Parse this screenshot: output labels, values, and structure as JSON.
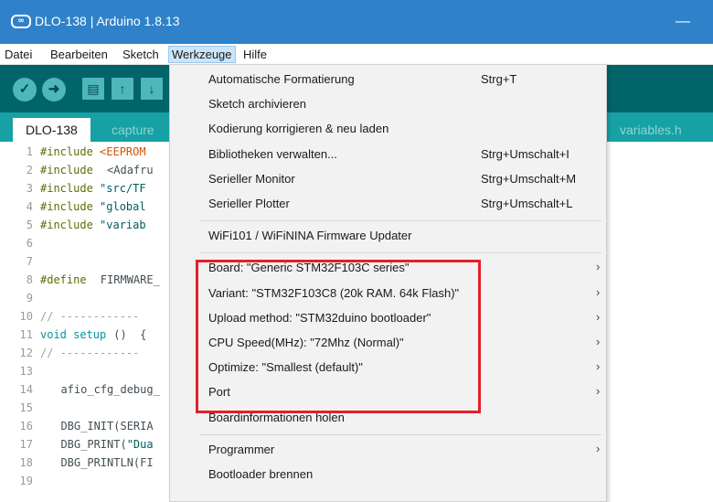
{
  "window": {
    "title": "DLO-138 | Arduino 1.8.13",
    "minimize_glyph": "—"
  },
  "menubar": {
    "items": [
      "Datei",
      "Bearbeiten",
      "Sketch",
      "Werkzeuge",
      "Hilfe"
    ],
    "active": "Werkzeuge"
  },
  "toolbar": {
    "buttons": [
      "verify-icon",
      "upload-icon",
      "new-icon",
      "open-icon",
      "save-icon"
    ]
  },
  "tabs": {
    "active": "DLO-138",
    "others": [
      "capture",
      "variables.h"
    ]
  },
  "editor": {
    "lines": [
      {
        "n": "1",
        "parts": [
          [
            "kw",
            "#include "
          ],
          [
            "red",
            "<EEPROM"
          ]
        ]
      },
      {
        "n": "2",
        "parts": [
          [
            "kw",
            "#include "
          ],
          [
            "code",
            "<Adafru"
          ]
        ]
      },
      {
        "n": "3",
        "parts": [
          [
            "kw",
            "#include "
          ],
          [
            "str",
            "\"src/TF"
          ]
        ]
      },
      {
        "n": "4",
        "parts": [
          [
            "kw",
            "#include "
          ],
          [
            "str",
            "\"global"
          ]
        ]
      },
      {
        "n": "5",
        "parts": [
          [
            "kw",
            "#include "
          ],
          [
            "str",
            "\"variab"
          ]
        ]
      },
      {
        "n": "6",
        "parts": []
      },
      {
        "n": "7",
        "parts": []
      },
      {
        "n": "8",
        "parts": [
          [
            "kw",
            "#define "
          ],
          [
            "code",
            "FIRMWARE_"
          ]
        ]
      },
      {
        "n": "9",
        "parts": []
      },
      {
        "n": "10",
        "parts": [
          [
            "cm",
            "// ------------"
          ]
        ]
      },
      {
        "n": "11",
        "parts": [
          [
            "fn",
            "void "
          ],
          [
            "fn",
            "setup"
          ],
          [
            "code",
            "()  {"
          ]
        ]
      },
      {
        "n": "12",
        "parts": [
          [
            "cm",
            "// ------------"
          ]
        ]
      },
      {
        "n": "13",
        "parts": []
      },
      {
        "n": "14",
        "parts": [
          [
            "code",
            "  afio_cfg_debug_"
          ]
        ]
      },
      {
        "n": "15",
        "parts": []
      },
      {
        "n": "16",
        "parts": [
          [
            "code",
            "  DBG_INIT(SERIA"
          ]
        ]
      },
      {
        "n": "17",
        "parts": [
          [
            "code",
            "  DBG_PRINT("
          ],
          [
            "str",
            "\"Dua"
          ]
        ]
      },
      {
        "n": "18",
        "parts": [
          [
            "code",
            "  DBG_PRINTLN(FI"
          ]
        ]
      },
      {
        "n": "19",
        "parts": []
      }
    ]
  },
  "dropdown": {
    "items": [
      {
        "label": "Automatische Formatierung",
        "shortcut": "Strg+T",
        "arrow": false
      },
      {
        "label": "Sketch archivieren",
        "shortcut": "",
        "arrow": false
      },
      {
        "label": "Kodierung korrigieren & neu laden",
        "shortcut": "",
        "arrow": false
      },
      {
        "label": "Bibliotheken verwalten...",
        "shortcut": "Strg+Umschalt+I",
        "arrow": false
      },
      {
        "label": "Serieller Monitor",
        "shortcut": "Strg+Umschalt+M",
        "arrow": false
      },
      {
        "label": "Serieller Plotter",
        "shortcut": "Strg+Umschalt+L",
        "arrow": false
      },
      {
        "separator": true
      },
      {
        "label": "WiFi101 / WiFiNINA Firmware Updater",
        "shortcut": "",
        "arrow": false
      },
      {
        "separator": true
      },
      {
        "label": "Board: \"Generic STM32F103C series\"",
        "shortcut": "",
        "arrow": true
      },
      {
        "label": "Variant: \"STM32F103C8 (20k RAM. 64k Flash)\"",
        "shortcut": "",
        "arrow": true
      },
      {
        "label": "Upload method: \"STM32duino bootloader\"",
        "shortcut": "",
        "arrow": true
      },
      {
        "label": "CPU Speed(MHz): \"72Mhz (Normal)\"",
        "shortcut": "",
        "arrow": true
      },
      {
        "label": "Optimize: \"Smallest (default)\"",
        "shortcut": "",
        "arrow": true
      },
      {
        "label": "Port",
        "shortcut": "",
        "arrow": true
      },
      {
        "label": "Boardinformationen holen",
        "shortcut": "",
        "arrow": false
      },
      {
        "separator": true
      },
      {
        "label": "Programmer",
        "shortcut": "",
        "arrow": true
      },
      {
        "label": "Bootloader brennen",
        "shortcut": "",
        "arrow": false
      }
    ]
  },
  "colors": {
    "titlebar": "#2f82c9",
    "toolbar": "#006468",
    "tabbar": "#17a1a5",
    "highlight": "#e2202b"
  }
}
